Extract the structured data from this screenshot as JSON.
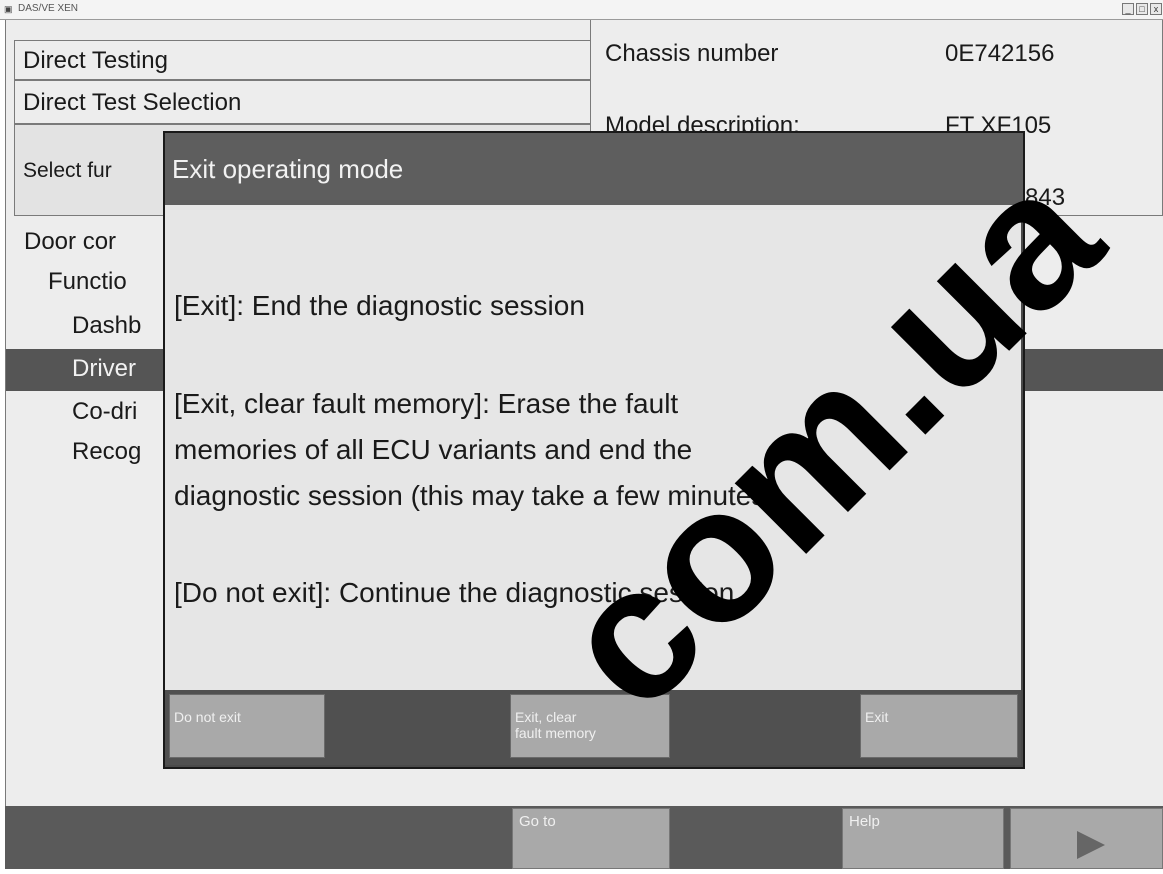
{
  "window": {
    "title": "DAS/VE XEN",
    "controls": [
      "_",
      "□",
      "x"
    ]
  },
  "header": {
    "title": "Direct Testing",
    "subtitle": "Direct Test Selection",
    "instruction": "Select fur"
  },
  "vehicle_info": {
    "chassis_label": "Chassis number",
    "chassis_value": "0E742156",
    "model_label": "Model description:",
    "model_value": "FT XF105",
    "third_value": "843"
  },
  "tree": [
    {
      "label": "Door cor"
    },
    {
      "label": "Functio"
    },
    {
      "label": "Dashb"
    },
    {
      "label": "Driver"
    },
    {
      "label": "Co-dri"
    },
    {
      "label": "Recog"
    }
  ],
  "dialog": {
    "title": "Exit operating mode",
    "message1": "[Exit]: End the diagnostic session",
    "message2_line1": "[Exit, clear fault memory]: Erase the fault",
    "message2_line2": "memories of all ECU variants and end the",
    "message2_line3": "diagnostic session (this may take a few minutes)",
    "message3": "[Do not exit]: Continue the diagnostic session",
    "buttons": {
      "do_not_exit": "Do not exit",
      "exit_clear_line1": "Exit, clear",
      "exit_clear_line2": "fault memory",
      "exit": "Exit"
    }
  },
  "toolbar": {
    "goto": "Go to",
    "help": "Help",
    "next_icon": "play-arrow-icon"
  },
  "watermark": {
    "text": "com.ua"
  },
  "colors": {
    "panel": "#ededed",
    "dialog_title_bar": "#5e5e5e",
    "selected_row": "#555555",
    "button": "#a9a9a9"
  }
}
